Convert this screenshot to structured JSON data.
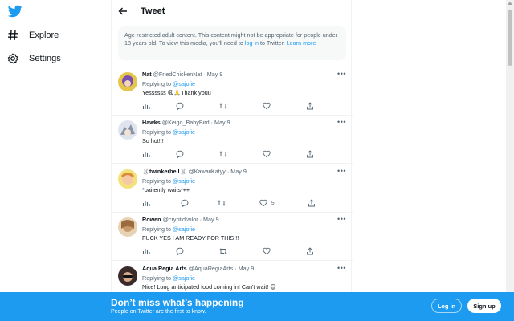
{
  "nav": {
    "logo_icon": "twitter-bird-icon",
    "items": [
      {
        "label": "Explore",
        "icon": "hashtag-icon"
      },
      {
        "label": "Settings",
        "icon": "gear-icon"
      }
    ]
  },
  "header": {
    "title": "Tweet"
  },
  "notice": {
    "text": "Age-restricted adult content. This content might not be appropriate for people under 18 years old. To view this media, you'll need to ",
    "link_login": "log in",
    "text_mid": " to Twitter. ",
    "link_more": "Learn more"
  },
  "replying_to_prefix": "Replying to ",
  "replies": [
    {
      "name": "Nat",
      "handle": "@FriedChickenNat",
      "date": "· May 9",
      "replying_to": "@sajofie",
      "text": "Yessssss 😩🙏Thank youu",
      "likes": ""
    },
    {
      "name": "Hawks",
      "handle": "@Keigo_BabyBird",
      "date": "· May 9",
      "replying_to": "@sajofie",
      "text": "So hot!!!",
      "likes": ""
    },
    {
      "name": "🐰twinkerbell🐰",
      "handle": "@KawaiiKatyy",
      "date": "· May 9",
      "replying_to": "@sajofie",
      "text": "*paitently waits*++",
      "likes": "5"
    },
    {
      "name": "Rowen",
      "handle": "@cryptidtailor",
      "date": "· May 9",
      "replying_to": "@sajofie",
      "text": "FUCK YES I AM READY FOR THIS !!",
      "likes": ""
    },
    {
      "name": "Aqua Regia Arts",
      "handle": "@AquaRegiaArts",
      "date": "· May 9",
      "replying_to": "@sajofie",
      "text": "Nice! Long anticipated food coming in! Can't wait! 😍",
      "likes": ""
    }
  ],
  "banner": {
    "headline": "Don’t miss what’s happening",
    "subtext": "People on Twitter are the first to know.",
    "login_label": "Log in",
    "signup_label": "Sign up"
  },
  "colors": {
    "accent": "#1d9bf0",
    "text": "#0f1419",
    "secondary": "#536471"
  }
}
